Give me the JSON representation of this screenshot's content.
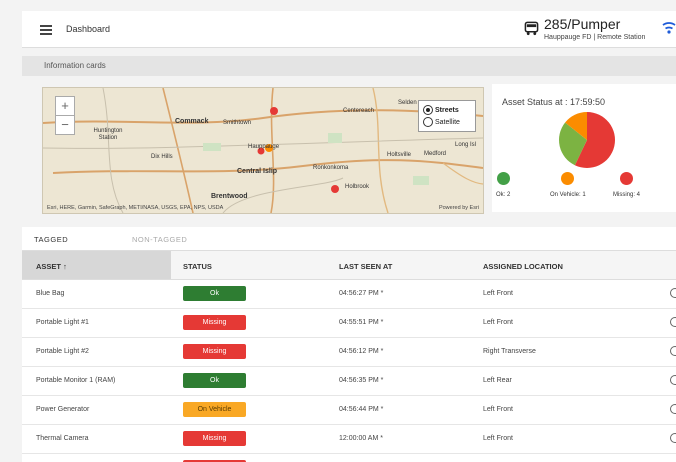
{
  "topbar": {
    "title": "Dashboard",
    "unit_name": "285/Pumper",
    "unit_sub": "Hauppauge FD | Remote Station"
  },
  "section_title": "Information cards",
  "map": {
    "zoom_in": "+",
    "zoom_out": "−",
    "layer_options": [
      "Streets",
      "Satellite"
    ],
    "selected_layer": "Streets",
    "places": [
      "Commack",
      "Smithtown",
      "Huntington Station",
      "Centereach",
      "Selden",
      "Dix Hills",
      "Hauppauge",
      "Central Islip",
      "Ronkonkoma",
      "Holtsville",
      "Medford",
      "Brentwood",
      "Holbrook",
      "Long Isl"
    ],
    "attribution": "Esri, HERE, Garmin, SafeGraph, METI/NASA, USGS, EPA, NPS, USDA",
    "powered_by": "Powered by Esri"
  },
  "status_card": {
    "header": "Asset Status at : 17:59:50",
    "legend": [
      {
        "label": "Ok: 2",
        "color": "#43a047"
      },
      {
        "label": "On Vehicle: 1",
        "color": "#fb8c00"
      },
      {
        "label": "Missing: 4",
        "color": "#e53935"
      }
    ],
    "pie": [
      {
        "name": "Missing",
        "value": 4,
        "color": "#e53935"
      },
      {
        "name": "Ok",
        "value": 2,
        "color": "#7cb342"
      },
      {
        "name": "On Vehicle",
        "value": 1,
        "color": "#fb8c00"
      }
    ]
  },
  "tabs": [
    "TAGGED",
    "NON-TAGGED"
  ],
  "table": {
    "headers": [
      "ASSET ↑",
      "STATUS",
      "LAST SEEN AT",
      "ASSIGNED LOCATION"
    ],
    "rows": [
      {
        "asset": "Blue Bag",
        "status": "Ok",
        "last_seen": "04:56:27 PM *",
        "location": "Left Front"
      },
      {
        "asset": "Portable Light #1",
        "status": "Missing",
        "last_seen": "04:55:51 PM *",
        "location": "Left Front"
      },
      {
        "asset": "Portable Light #2",
        "status": "Missing",
        "last_seen": "04:56:12 PM *",
        "location": "Right Transverse"
      },
      {
        "asset": "Portable Monitor 1 (RAM)",
        "status": "Ok",
        "last_seen": "04:56:35 PM *",
        "location": "Left Rear"
      },
      {
        "asset": "Power Generator",
        "status": "On Vehicle",
        "last_seen": "04:56:44 PM *",
        "location": "Left Front"
      },
      {
        "asset": "Thermal Camera",
        "status": "Missing",
        "last_seen": "12:00:00 AM *",
        "location": "Left Front"
      },
      {
        "asset": "",
        "status": "Missing",
        "last_seen": "",
        "location": ""
      }
    ]
  }
}
